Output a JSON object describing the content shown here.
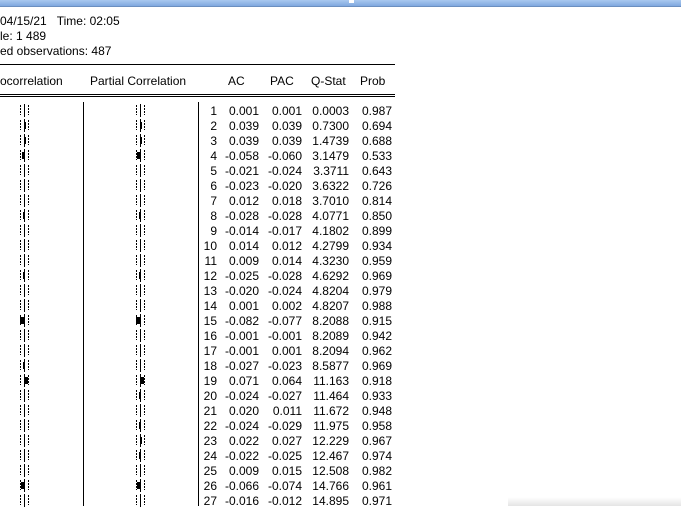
{
  "header": {
    "line1_date": "04/15/21",
    "line1_time_label": "Time: 02:05",
    "line2": "le: 1 489",
    "line3": "ed observations: 487"
  },
  "columns": {
    "autocorrelation": "ocorrelation",
    "partial_correlation": "Partial Correlation",
    "ac": "AC",
    "pac": "PAC",
    "qstat": "Q-Stat",
    "prob": "Prob"
  },
  "rows": [
    {
      "lag": "1",
      "ac": "0.001",
      "pac": "0.001",
      "q": "0.0003",
      "prob": "0.987"
    },
    {
      "lag": "2",
      "ac": "0.039",
      "pac": "0.039",
      "q": "0.7300",
      "prob": "0.694"
    },
    {
      "lag": "3",
      "ac": "0.039",
      "pac": "0.039",
      "q": "1.4739",
      "prob": "0.688"
    },
    {
      "lag": "4",
      "ac": "-0.058",
      "pac": "-0.060",
      "q": "3.1479",
      "prob": "0.533"
    },
    {
      "lag": "5",
      "ac": "-0.021",
      "pac": "-0.024",
      "q": "3.3711",
      "prob": "0.643"
    },
    {
      "lag": "6",
      "ac": "-0.023",
      "pac": "-0.020",
      "q": "3.6322",
      "prob": "0.726"
    },
    {
      "lag": "7",
      "ac": "0.012",
      "pac": "0.018",
      "q": "3.7010",
      "prob": "0.814"
    },
    {
      "lag": "8",
      "ac": "-0.028",
      "pac": "-0.028",
      "q": "4.0771",
      "prob": "0.850"
    },
    {
      "lag": "9",
      "ac": "-0.014",
      "pac": "-0.017",
      "q": "4.1802",
      "prob": "0.899"
    },
    {
      "lag": "10",
      "ac": "0.014",
      "pac": "0.012",
      "q": "4.2799",
      "prob": "0.934"
    },
    {
      "lag": "11",
      "ac": "0.009",
      "pac": "0.014",
      "q": "4.3230",
      "prob": "0.959"
    },
    {
      "lag": "12",
      "ac": "-0.025",
      "pac": "-0.028",
      "q": "4.6292",
      "prob": "0.969"
    },
    {
      "lag": "13",
      "ac": "-0.020",
      "pac": "-0.024",
      "q": "4.8204",
      "prob": "0.979"
    },
    {
      "lag": "14",
      "ac": "0.001",
      "pac": "0.002",
      "q": "4.8207",
      "prob": "0.988"
    },
    {
      "lag": "15",
      "ac": "-0.082",
      "pac": "-0.077",
      "q": "8.2088",
      "prob": "0.915"
    },
    {
      "lag": "16",
      "ac": "-0.001",
      "pac": "-0.001",
      "q": "8.2089",
      "prob": "0.942"
    },
    {
      "lag": "17",
      "ac": "-0.001",
      "pac": "0.001",
      "q": "8.2094",
      "prob": "0.962"
    },
    {
      "lag": "18",
      "ac": "-0.027",
      "pac": "-0.023",
      "q": "8.5877",
      "prob": "0.969"
    },
    {
      "lag": "19",
      "ac": "0.071",
      "pac": "0.064",
      "q": "11.163",
      "prob": "0.918"
    },
    {
      "lag": "20",
      "ac": "-0.024",
      "pac": "-0.027",
      "q": "11.464",
      "prob": "0.933"
    },
    {
      "lag": "21",
      "ac": "0.020",
      "pac": "0.011",
      "q": "11.672",
      "prob": "0.948"
    },
    {
      "lag": "22",
      "ac": "-0.024",
      "pac": "-0.029",
      "q": "11.975",
      "prob": "0.958"
    },
    {
      "lag": "23",
      "ac": "0.022",
      "pac": "0.027",
      "q": "12.229",
      "prob": "0.967"
    },
    {
      "lag": "24",
      "ac": "-0.022",
      "pac": "-0.025",
      "q": "12.467",
      "prob": "0.974"
    },
    {
      "lag": "25",
      "ac": "0.009",
      "pac": "0.015",
      "q": "12.508",
      "prob": "0.982"
    },
    {
      "lag": "26",
      "ac": "-0.066",
      "pac": "-0.074",
      "q": "14.766",
      "prob": "0.961"
    },
    {
      "lag": "27",
      "ac": "-0.016",
      "pac": "-0.012",
      "q": "14.895",
      "prob": "0.971"
    }
  ]
}
